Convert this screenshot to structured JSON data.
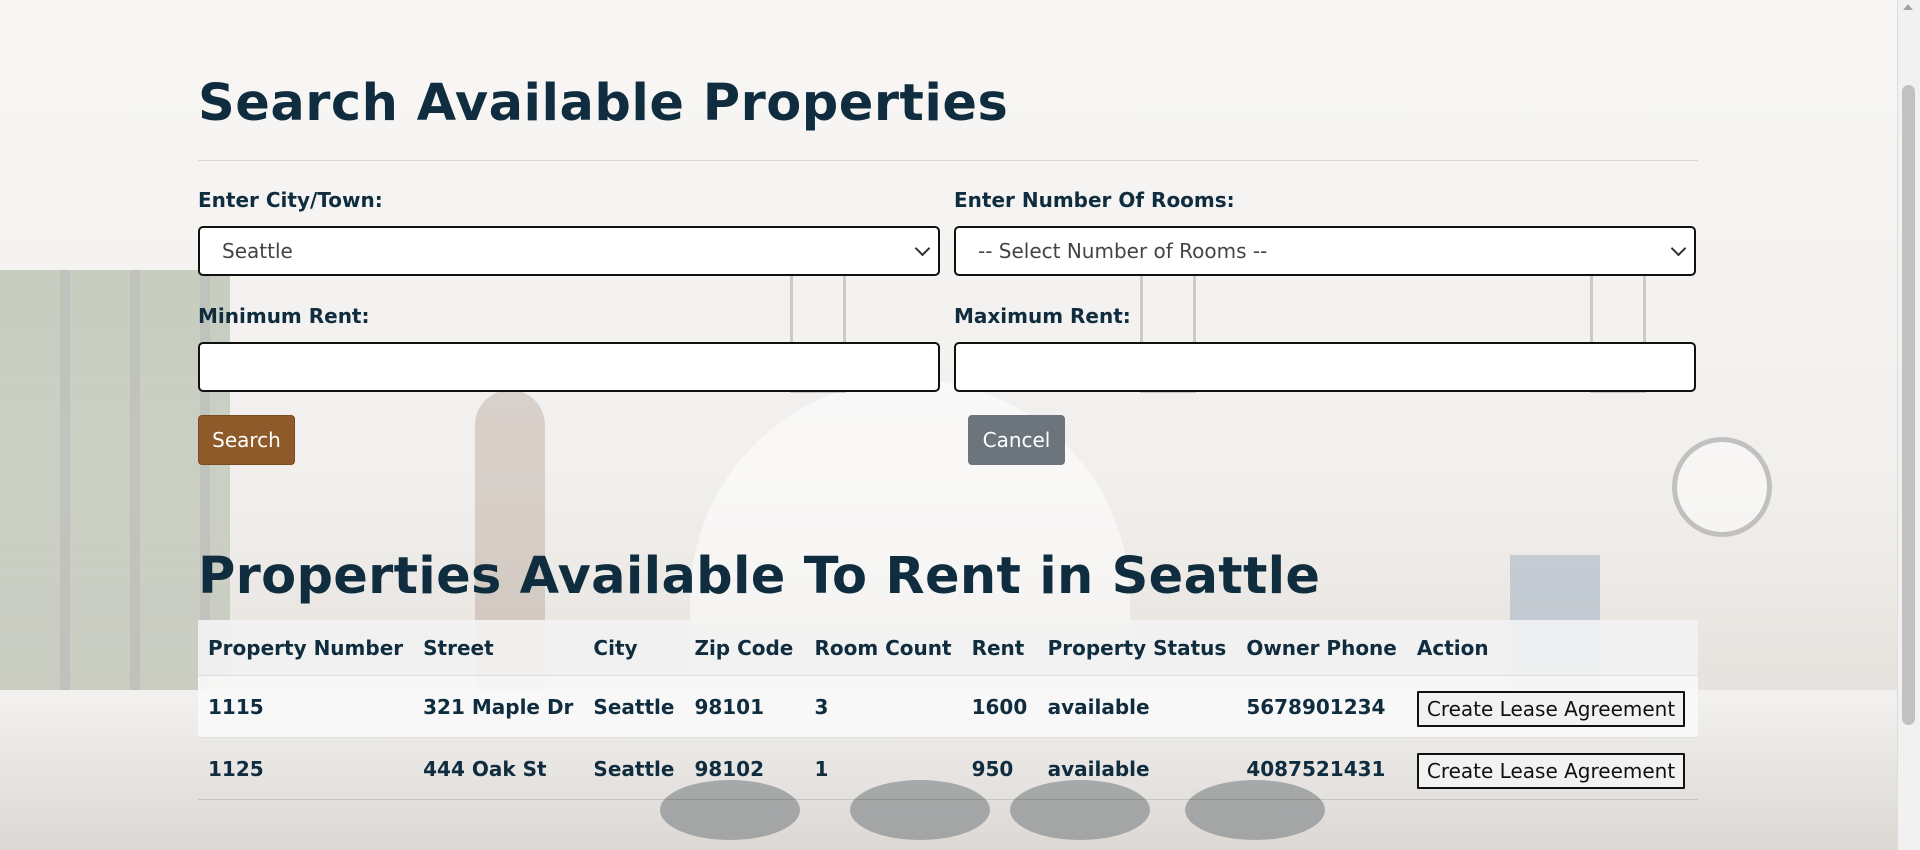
{
  "page": {
    "title": "Search Available Properties",
    "results_title": "Properties Available To Rent in Seattle"
  },
  "search_form": {
    "city_label": "Enter City/Town:",
    "city_value": "Seattle",
    "rooms_label": "Enter Number Of Rooms:",
    "rooms_value": "-- Select Number of Rooms --",
    "min_rent_label": "Minimum Rent:",
    "min_rent_value": "",
    "max_rent_label": "Maximum Rent:",
    "max_rent_value": "",
    "search_label": "Search",
    "cancel_label": "Cancel"
  },
  "table": {
    "headers": [
      "Property Number",
      "Street",
      "City",
      "Zip Code",
      "Room Count",
      "Rent",
      "Property Status",
      "Owner Phone",
      "Action"
    ],
    "rows": [
      {
        "property_number": "1115",
        "street": "321 Maple Dr",
        "city": "Seattle",
        "zip": "98101",
        "rooms": "3",
        "rent": "1600",
        "status": "available",
        "phone": "5678901234",
        "action": "Create Lease Agreement"
      },
      {
        "property_number": "1125",
        "street": "444 Oak St",
        "city": "Seattle",
        "zip": "98102",
        "rooms": "1",
        "rent": "950",
        "status": "available",
        "phone": "4087521431",
        "action": "Create Lease Agreement"
      }
    ]
  },
  "colors": {
    "search_button": "#8e5a2a",
    "cancel_button": "#6c757d",
    "heading": "#0f2d3f"
  },
  "icons": {
    "select_arrow": "chevron-down-icon"
  }
}
